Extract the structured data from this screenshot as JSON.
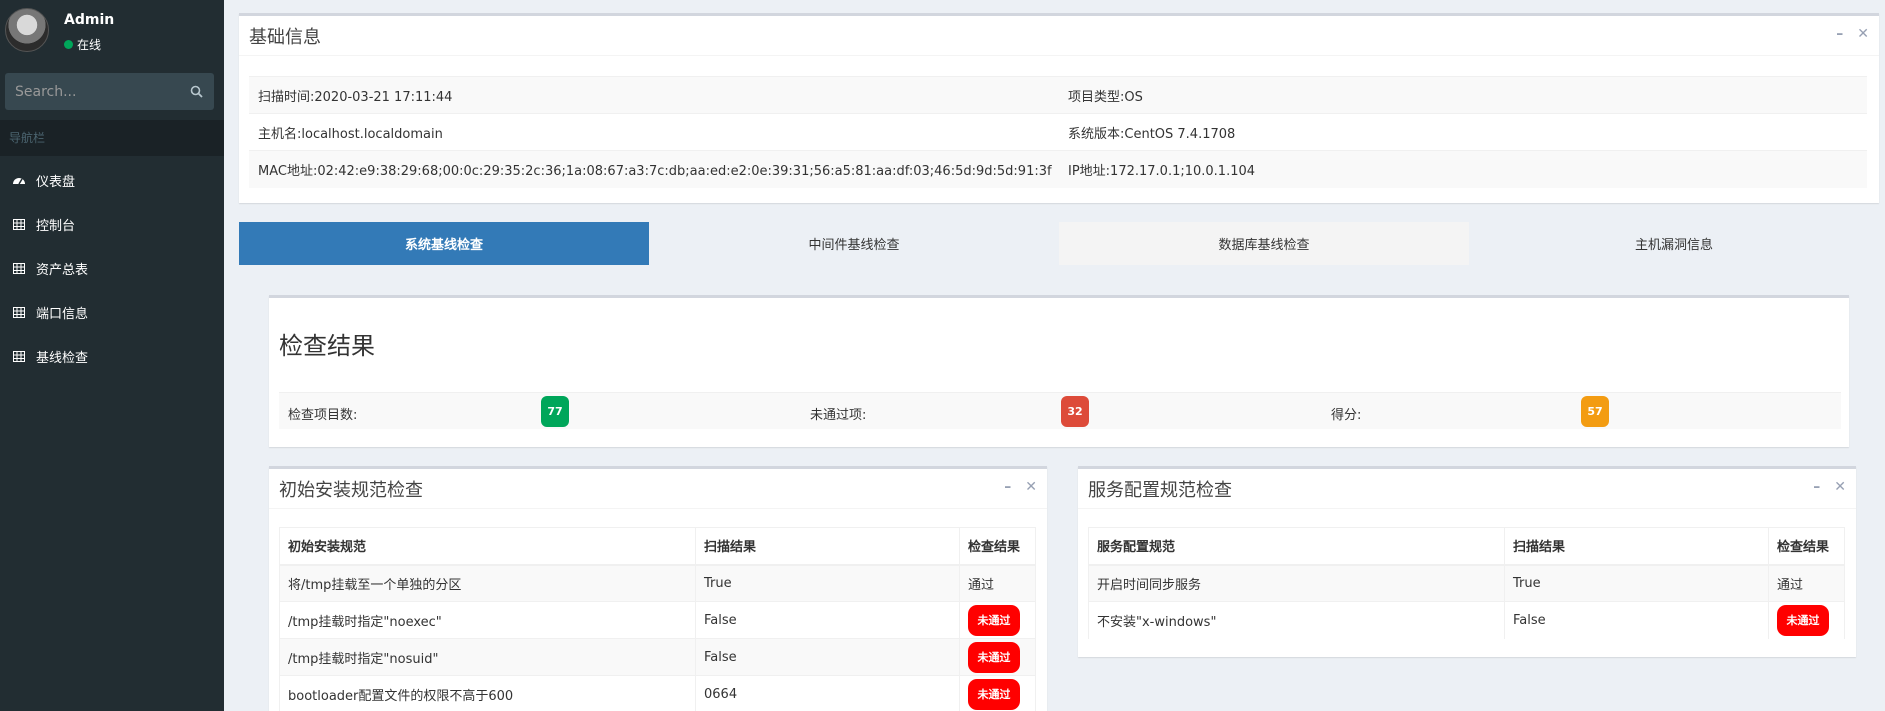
{
  "sidebar": {
    "user_name": "Admin",
    "user_status": "在线",
    "search_placeholder": "Search...",
    "nav_header": "导航栏",
    "items": [
      {
        "label": "仪表盘",
        "icon": "dashboard-icon"
      },
      {
        "label": "控制台",
        "icon": "table-icon"
      },
      {
        "label": "资产总表",
        "icon": "table-icon"
      },
      {
        "label": "端口信息",
        "icon": "table-icon"
      },
      {
        "label": "基线检查",
        "icon": "table-icon"
      }
    ]
  },
  "basic_info": {
    "title": "基础信息",
    "rows": [
      {
        "left": "扫描时间:2020-03-21 17:11:44",
        "right": "项目类型:OS"
      },
      {
        "left": "主机名:localhost.localdomain",
        "right": "系统版本:CentOS 7.4.1708"
      },
      {
        "left": "MAC地址:02:42:e9:38:29:68;00:0c:29:35:2c:36;1a:08:67:a3:7c:db;aa:ed:e2:0e:39:31;56:a5:81:aa:df:03;46:5d:9d:5d:91:3f",
        "right": "IP地址:172.17.0.1;10.0.1.104"
      }
    ]
  },
  "tabs": [
    "系统基线检查",
    "中间件基线检查",
    "数据库基线检查",
    "主机漏洞信息"
  ],
  "check_result": {
    "title": "检查结果",
    "total_label": "检查项目数:",
    "total_value": "77",
    "failed_label": "未通过项:",
    "failed_value": "32",
    "score_label": "得分:",
    "score_value": "57"
  },
  "install_check": {
    "title": "初始安装规范检查",
    "headers": [
      "初始安装规范",
      "扫描结果",
      "检查结果"
    ],
    "rows": [
      {
        "item": "将/tmp挂载至一个单独的分区",
        "scan": "True",
        "result": "通过",
        "pass": true
      },
      {
        "item": "/tmp挂载时指定\"noexec\"",
        "scan": "False",
        "result": "未通过",
        "pass": false
      },
      {
        "item": "/tmp挂载时指定\"nosuid\"",
        "scan": "False",
        "result": "未通过",
        "pass": false
      },
      {
        "item": "bootloader配置文件的权限不高于600",
        "scan": "0664",
        "result": "未通过",
        "pass": false
      }
    ]
  },
  "service_check": {
    "title": "服务配置规范检查",
    "headers": [
      "服务配置规范",
      "扫描结果",
      "检查结果"
    ],
    "rows": [
      {
        "item": "开启时间同步服务",
        "scan": "True",
        "result": "通过",
        "pass": true
      },
      {
        "item": "不安装\"x-windows\"",
        "scan": "False",
        "result": "未通过",
        "pass": false
      }
    ]
  },
  "colors": {
    "sidebar_bg": "#222d32",
    "active_tab": "#337ab7",
    "badge_green": "#00a65a",
    "badge_red": "#dd4b39",
    "badge_orange": "#f39c12",
    "fail_red": "#ff0000"
  }
}
